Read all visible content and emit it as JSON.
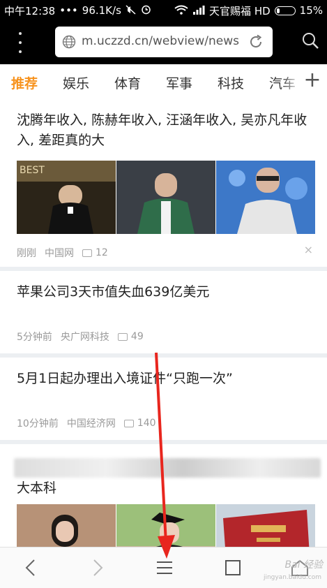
{
  "status_bar": {
    "time": "中午12:38",
    "dots": "•••",
    "speed": "96.1K/s",
    "carrier": "天官赐福 HD",
    "battery": "15%"
  },
  "address_bar": {
    "url": "m.uczzd.cn/webview/newslis"
  },
  "tabs": [
    {
      "label": "推荐",
      "active": true
    },
    {
      "label": "娱乐"
    },
    {
      "label": "体育"
    },
    {
      "label": "军事"
    },
    {
      "label": "科技"
    },
    {
      "label": "汽车"
    }
  ],
  "tab_plus": "+",
  "articles": [
    {
      "title": "沈腾年收入, 陈赫年收入, 汪涵年收入, 吴亦凡年收入, 差距真的大",
      "time": "刚刚",
      "source": "中国网",
      "comments": "12"
    },
    {
      "title": "苹果公司3天市值失血639亿美元",
      "time": "5分钟前",
      "source": "央广网科技",
      "comments": "49"
    },
    {
      "title": "5月1日起办理出入境证件“只跑一次”",
      "time": "10分钟前",
      "source": "中国经济网",
      "comments": "140"
    },
    {
      "title": "大本科"
    }
  ],
  "close_symbol": "×",
  "watermark": {
    "line1": "Bai 经验",
    "line2": "jingyan.baidu.com"
  },
  "colors": {
    "accent": "#f7931e",
    "arrow": "#e8261e"
  }
}
